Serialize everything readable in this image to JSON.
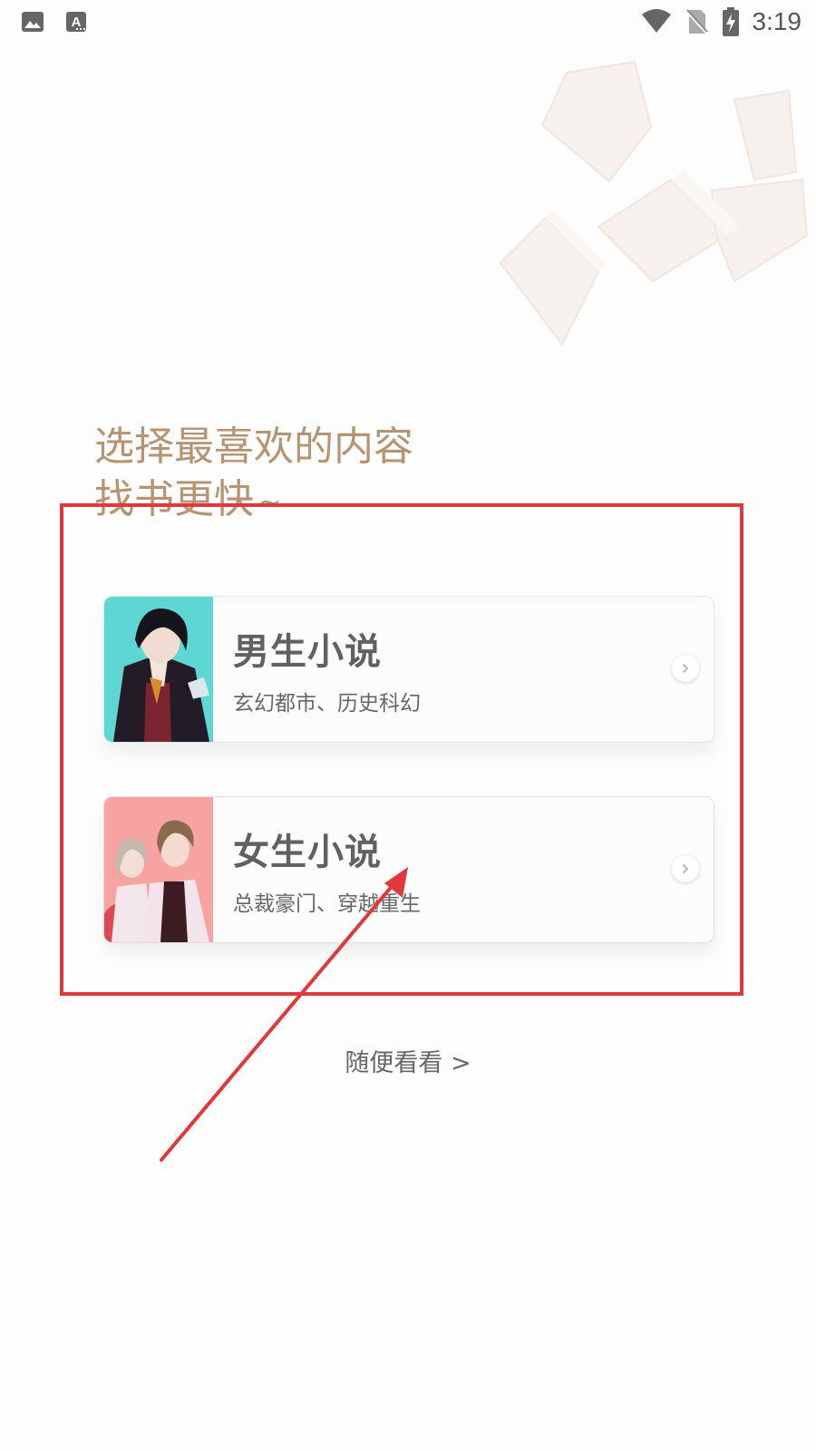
{
  "status_bar": {
    "time": "3:19",
    "left_icons": [
      "image-icon",
      "font-a-icon"
    ],
    "right_icons": [
      "wifi-icon",
      "no-sim-icon",
      "battery-charging-icon"
    ]
  },
  "onboarding": {
    "heading_line1": "选择最喜欢的内容",
    "heading_line2": "找书更快",
    "heading_tilde": "~",
    "accent_color": "#b59472"
  },
  "categories": [
    {
      "title": "男生小说",
      "subtitle": "玄幻都市、历史科幻",
      "thumb_color": "#5ed6d4"
    },
    {
      "title": "女生小说",
      "subtitle": "总裁豪门、穿越重生",
      "thumb_color": "#f6a3a1"
    }
  ],
  "browse": {
    "label": "随便看看 >"
  },
  "annotation": {
    "color": "#e0393c"
  }
}
